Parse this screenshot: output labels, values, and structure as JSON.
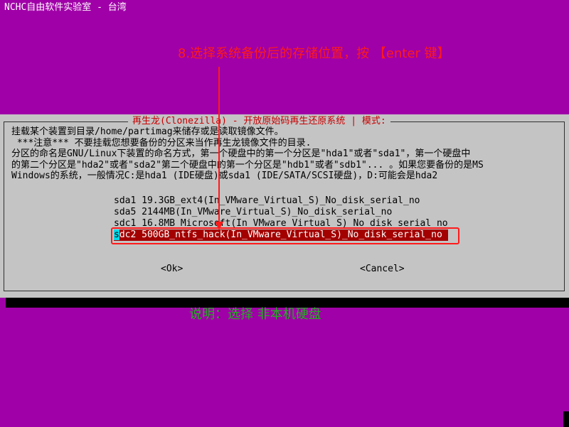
{
  "screen_title": "NCHC自由软件实验室 - 台湾",
  "annotations": {
    "top": "8.选择系统备份后的存储位置，按 【enter 键】",
    "bottom": "说明：选择 非本机硬盘",
    "colors": {
      "top": "#ff1a1a",
      "bottom": "#22b020"
    }
  },
  "dialog": {
    "title": "再生龙(Clonezilla) - 开放原始码再生还原系统 | 模式:",
    "text_lines": [
      "挂载某个装置到目录/home/partimag来储存或是读取镜像文件。",
      " ***注意*** 不要挂载您想要备份的分区来当作再生龙镜像文件的目录.",
      "分区的命名是GNU/Linux下装置的命名方式，第一个硬盘中的第一个分区是\"hda1\"或者\"sda1\"，第一个硬盘中",
      "的第二个分区是\"hda2\"或者\"sda2\"第二个硬盘中的第一个分区是\"hdb1\"或者\"sdb1\"... 。如果您要备份的是MS",
      "Windows的系统，一般情况C:是hda1 (IDE硬盘)或sda1 (IDE/SATA/SCSI硬盘)，D:可能会是hda2"
    ],
    "menu_items": [
      "sda1 19.3GB_ext4(In_VMware_Virtual_S)_No_disk_serial_no",
      "sda5 2144MB(In_VMware_Virtual_S)_No_disk_serial_no",
      "sdc1 16.8MB_Microsoft(In_VMware_Virtual_S)_No_disk_serial_no"
    ],
    "selected_item": {
      "cursor_char": "s",
      "rest": "dc2 500GB_ntfs_hack(In_VMware_Virtual_S)_No_disk_serial_no"
    },
    "ok_label": "<Ok>",
    "cancel_label": "<Cancel>"
  },
  "colors": {
    "background": "#a000a8",
    "dialog": "#c4c4c4",
    "selection": "#a30000",
    "cursor": "#00d8e8",
    "title_text": "#c80000"
  }
}
